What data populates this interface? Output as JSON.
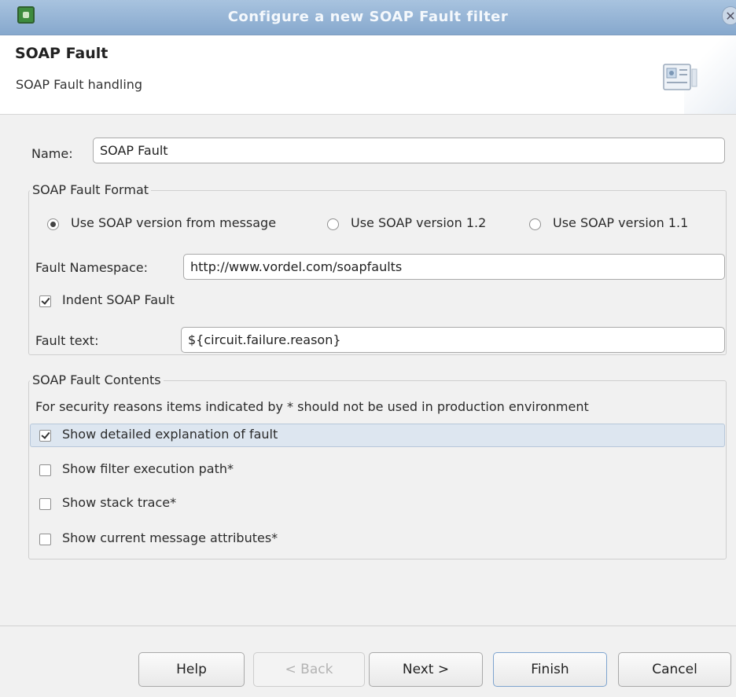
{
  "window": {
    "title": "Configure a new SOAP Fault filter",
    "close_glyph": "✕"
  },
  "header": {
    "title": "SOAP Fault",
    "subtitle": "SOAP Fault handling",
    "icon": "wizard-document-icon"
  },
  "form": {
    "name_label": "Name:",
    "name_value": "SOAP Fault",
    "format_group": {
      "legend": "SOAP Fault Format",
      "radios": [
        {
          "label": "Use SOAP version from message",
          "selected": true
        },
        {
          "label": "Use SOAP version 1.2",
          "selected": false
        },
        {
          "label": "Use SOAP version 1.1",
          "selected": false
        }
      ],
      "namespace_label": "Fault Namespace:",
      "namespace_value": "http://www.vordel.com/soapfaults",
      "indent_label": "Indent SOAP Fault",
      "indent_checked": true,
      "fault_text_label": "Fault text:",
      "fault_text_value": "${circuit.failure.reason}"
    },
    "contents_group": {
      "legend": "SOAP Fault Contents",
      "note": "For security reasons items indicated by * should not be used in production environment",
      "options": [
        {
          "label": "Show detailed explanation of fault",
          "checked": true
        },
        {
          "label": "Show filter execution path*",
          "checked": false
        },
        {
          "label": "Show stack trace*",
          "checked": false
        },
        {
          "label": "Show current message attributes*",
          "checked": false
        }
      ]
    }
  },
  "buttons": {
    "help": "Help",
    "back": "< Back",
    "next": "Next >",
    "finish": "Finish",
    "cancel": "Cancel"
  }
}
